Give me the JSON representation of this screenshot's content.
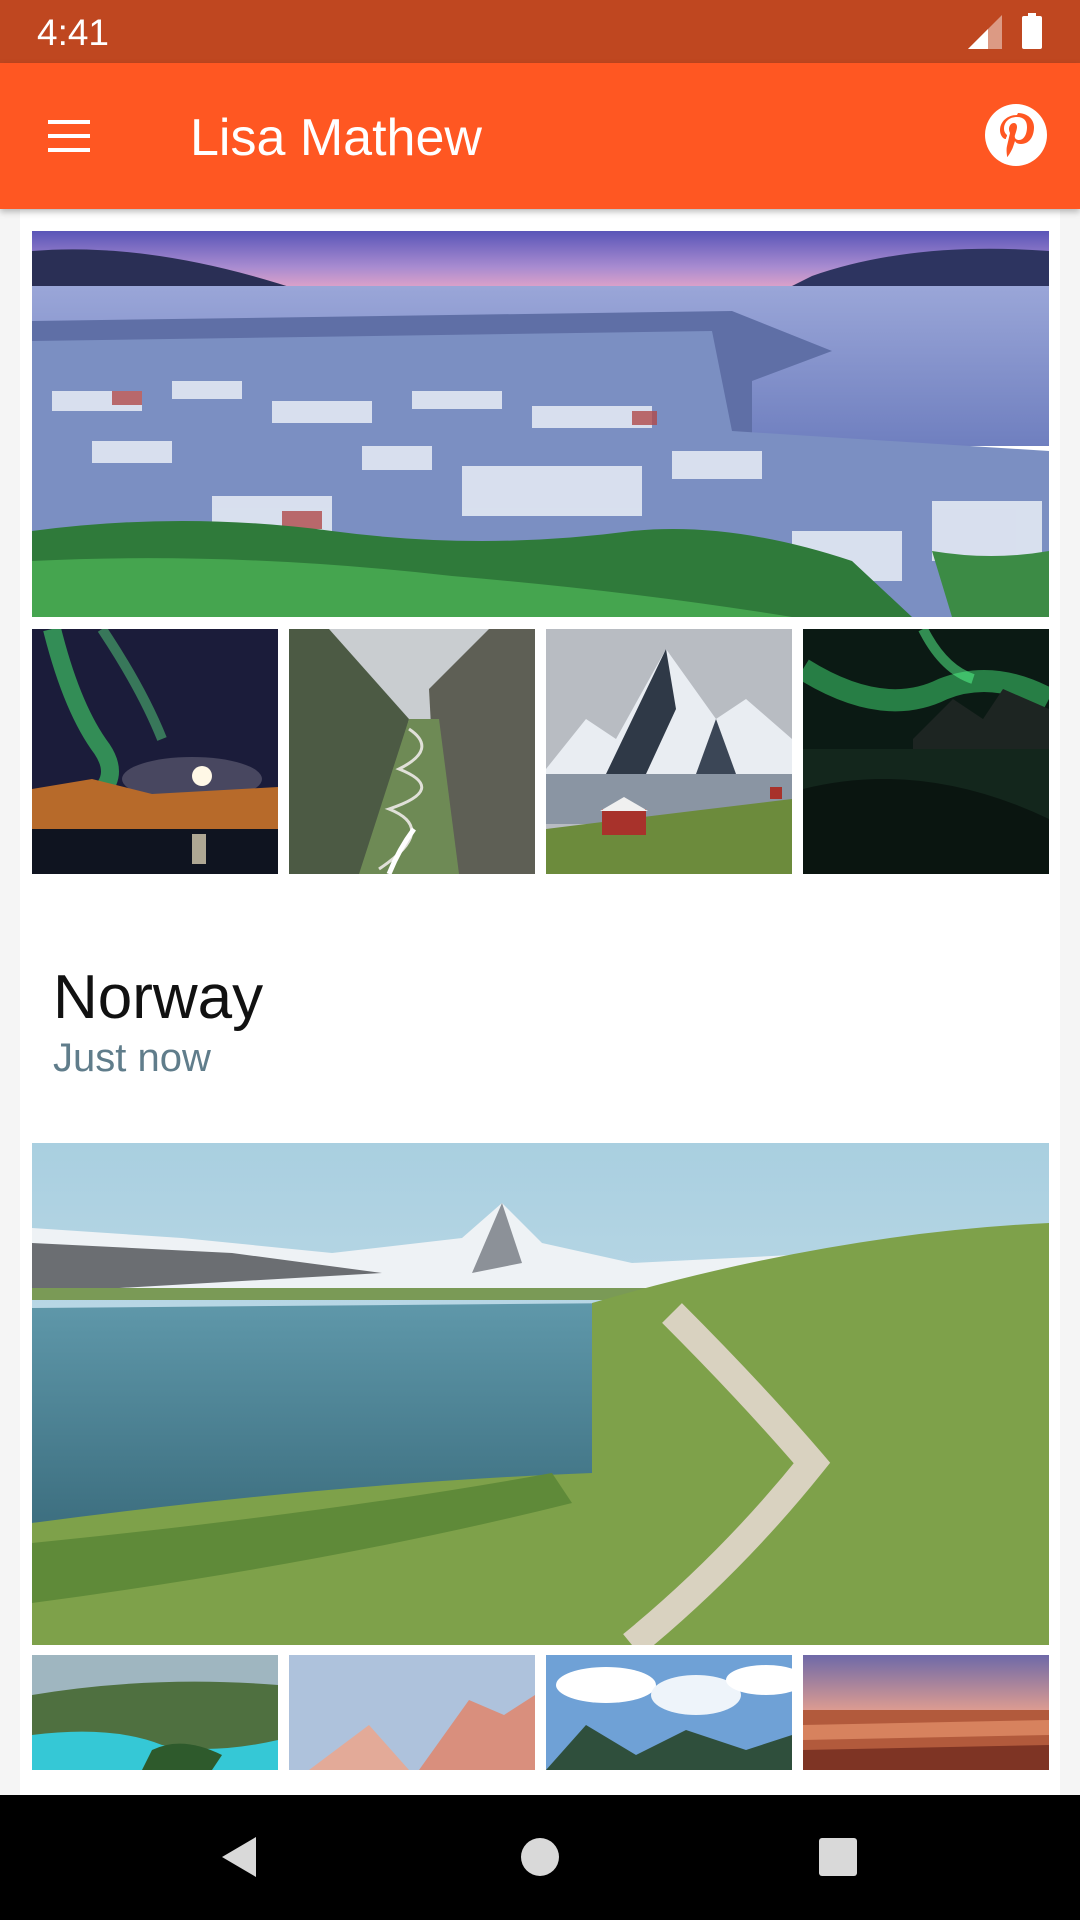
{
  "status_bar": {
    "time": "4:41"
  },
  "app_bar": {
    "title": "Lisa Mathew",
    "menu_icon": "menu-icon",
    "action_icon": "pinterest-icon"
  },
  "albums": [
    {
      "title": "Norway",
      "subtitle": "Just now"
    }
  ],
  "colors": {
    "status": "#BF4720",
    "appbar": "#FF5722",
    "subtitle": "#607D8B"
  }
}
